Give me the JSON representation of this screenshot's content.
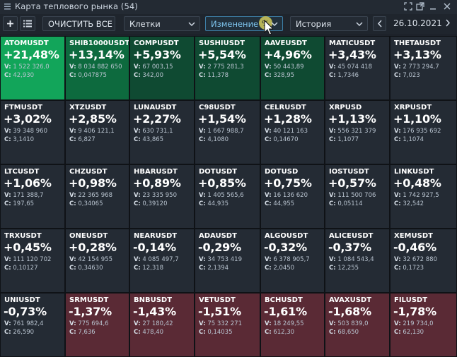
{
  "window": {
    "title": "Карта теплового рынка (54)",
    "icons": [
      "menu-icon",
      "maximize-icon",
      "popout-icon",
      "minimize-icon",
      "close-icon"
    ]
  },
  "toolbar": {
    "clear_all": "ОЧИСТИТЬ ВСЕ",
    "view_select": "Клетки",
    "metric_select": "Изменение",
    "metric_unit": "%",
    "history_select": "История",
    "date": "26.10.2021"
  },
  "colors": {
    "neutral": "#242b34",
    "green_strong": "#12a55a",
    "green_mid": "#0d6a3e",
    "green_dark": "#0f4a32",
    "red": "#5a2a35"
  },
  "tiles": [
    {
      "symbol": "ATOMUSDT",
      "change": "+21,48%",
      "volume": "1 522 326,0",
      "close": "42,930",
      "tone": "green_strong"
    },
    {
      "symbol": "SHIB1000USDT",
      "change": "+13,14%",
      "volume": "8 034 882 650",
      "close": "0,047875",
      "tone": "green_mid"
    },
    {
      "symbol": "COMPUSDT",
      "change": "+5,93%",
      "volume": "67 003,15",
      "close": "342,00",
      "tone": "green_dark"
    },
    {
      "symbol": "SUSHIUSDT",
      "change": "+5,54%",
      "volume": "2 775 281,3",
      "close": "11,378",
      "tone": "green_dark"
    },
    {
      "symbol": "AAVEUSDT",
      "change": "+4,96%",
      "volume": "50 443,89",
      "close": "328,95",
      "tone": "green_dark"
    },
    {
      "symbol": "MATICUSDT",
      "change": "+3,43%",
      "volume": "45 074 418",
      "close": "1,7346",
      "tone": "neutral"
    },
    {
      "symbol": "THETAUSDT",
      "change": "+3,13%",
      "volume": "2 773 294,7",
      "close": "7,023",
      "tone": "neutral"
    },
    {
      "symbol": "FTMUSDT",
      "change": "+3,02%",
      "volume": "39 348 960",
      "close": "3,1410",
      "tone": "neutral"
    },
    {
      "symbol": "XTZUSDT",
      "change": "+2,85%",
      "volume": "9 406 121,1",
      "close": "6,827",
      "tone": "neutral"
    },
    {
      "symbol": "LUNAUSDT",
      "change": "+2,27%",
      "volume": "630 731,1",
      "close": "43,865",
      "tone": "neutral"
    },
    {
      "symbol": "C98USDT",
      "change": "+1,54%",
      "volume": "1 667 988,7",
      "close": "4,1080",
      "tone": "neutral"
    },
    {
      "symbol": "CELRUSDT",
      "change": "+1,28%",
      "volume": "40 121 163",
      "close": "0,14670",
      "tone": "neutral"
    },
    {
      "symbol": "XRPUSD",
      "change": "+1,13%",
      "volume": "556 321 379",
      "close": "1,1077",
      "tone": "neutral"
    },
    {
      "symbol": "XRPUSDT",
      "change": "+1,10%",
      "volume": "176 935 692",
      "close": "1,1074",
      "tone": "neutral"
    },
    {
      "symbol": "LTCUSDT",
      "change": "+1,06%",
      "volume": "171 388,7",
      "close": "197,65",
      "tone": "neutral"
    },
    {
      "symbol": "CHZUSDT",
      "change": "+0,98%",
      "volume": "22 365 968",
      "close": "0,34065",
      "tone": "neutral"
    },
    {
      "symbol": "HBARUSDT",
      "change": "+0,89%",
      "volume": "23 335 950",
      "close": "0,39120",
      "tone": "neutral"
    },
    {
      "symbol": "DOTUSDT",
      "change": "+0,85%",
      "volume": "1 405 565,6",
      "close": "44,935",
      "tone": "neutral"
    },
    {
      "symbol": "DOTUSD",
      "change": "+0,75%",
      "volume": "16 136 620",
      "close": "44,955",
      "tone": "neutral"
    },
    {
      "symbol": "IOSTUSDT",
      "change": "+0,57%",
      "volume": "111 500 706",
      "close": "0,05114",
      "tone": "neutral"
    },
    {
      "symbol": "LINKUSDT",
      "change": "+0,48%",
      "volume": "1 742 927,5",
      "close": "32,542",
      "tone": "neutral"
    },
    {
      "symbol": "TRXUSDT",
      "change": "+0,45%",
      "volume": "111 120 702",
      "close": "0,10127",
      "tone": "neutral"
    },
    {
      "symbol": "ONEUSDT",
      "change": "+0,28%",
      "volume": "42 154 955",
      "close": "0,34630",
      "tone": "neutral"
    },
    {
      "symbol": "NEARUSDT",
      "change": "-0,14%",
      "volume": "4 085 497,7",
      "close": "12,318",
      "tone": "neutral"
    },
    {
      "symbol": "ADAUSDT",
      "change": "-0,29%",
      "volume": "34 753 419",
      "close": "2,1394",
      "tone": "neutral"
    },
    {
      "symbol": "ALGOUSDT",
      "change": "-0,32%",
      "volume": "6 378 905,7",
      "close": "2,0450",
      "tone": "neutral"
    },
    {
      "symbol": "ALICEUSDT",
      "change": "-0,37%",
      "volume": "1 084 543,4",
      "close": "12,255",
      "tone": "neutral"
    },
    {
      "symbol": "XEMUSDT",
      "change": "-0,46%",
      "volume": "32 672 880",
      "close": "0,1723",
      "tone": "neutral"
    },
    {
      "symbol": "UNIUSDT",
      "change": "-0,73%",
      "volume": "761 982,4",
      "close": "26,590",
      "tone": "neutral"
    },
    {
      "symbol": "SRMUSDT",
      "change": "-1,37%",
      "volume": "775 694,6",
      "close": "7,636",
      "tone": "red"
    },
    {
      "symbol": "BNBUSDT",
      "change": "-1,43%",
      "volume": "27 180,42",
      "close": "478,40",
      "tone": "red"
    },
    {
      "symbol": "VETUSDT",
      "change": "-1,51%",
      "volume": "75 332 271",
      "close": "0,14035",
      "tone": "red"
    },
    {
      "symbol": "BCHUSDT",
      "change": "-1,61%",
      "volume": "18 249,55",
      "close": "612,30",
      "tone": "red"
    },
    {
      "symbol": "AVAXUSDT",
      "change": "-1,68%",
      "volume": "503 839,0",
      "close": "68,650",
      "tone": "red"
    },
    {
      "symbol": "FILUSDT",
      "change": "-1,78%",
      "volume": "219 734,0",
      "close": "62,130",
      "tone": "red"
    }
  ],
  "labels": {
    "volume_prefix": "V:",
    "close_prefix": "C:"
  }
}
